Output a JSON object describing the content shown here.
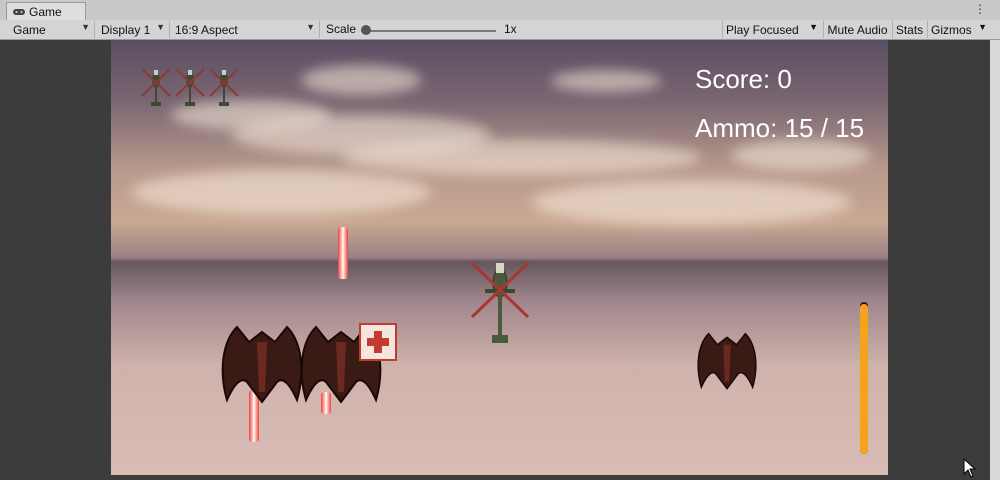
{
  "window": {
    "tab_label": "Game",
    "tab_icon": "gamepad-icon",
    "menu_icon": "kebab-icon"
  },
  "toolbar": {
    "game_dropdown": "Game",
    "display_dropdown": "Display 1",
    "aspect_dropdown": "16:9 Aspect",
    "scale_label": "Scale",
    "scale_value": "1x",
    "scale_fraction": 0.0,
    "play_focused": "Play Focused",
    "mute_audio": "Mute Audio",
    "stats": "Stats",
    "gizmos": "Gizmos"
  },
  "hud": {
    "score_text": "Score: 0",
    "ammo_text": "Ammo: 15 / 15",
    "lives_count": 3,
    "ammo_fraction": 1.0,
    "ammo_color": "#f2a51a",
    "laser_color": "#e8433e"
  },
  "scene": {
    "player": "helicopter",
    "enemies": [
      "enemy-ship",
      "enemy-ship",
      "enemy-ship"
    ],
    "pickup": "health-pack"
  }
}
